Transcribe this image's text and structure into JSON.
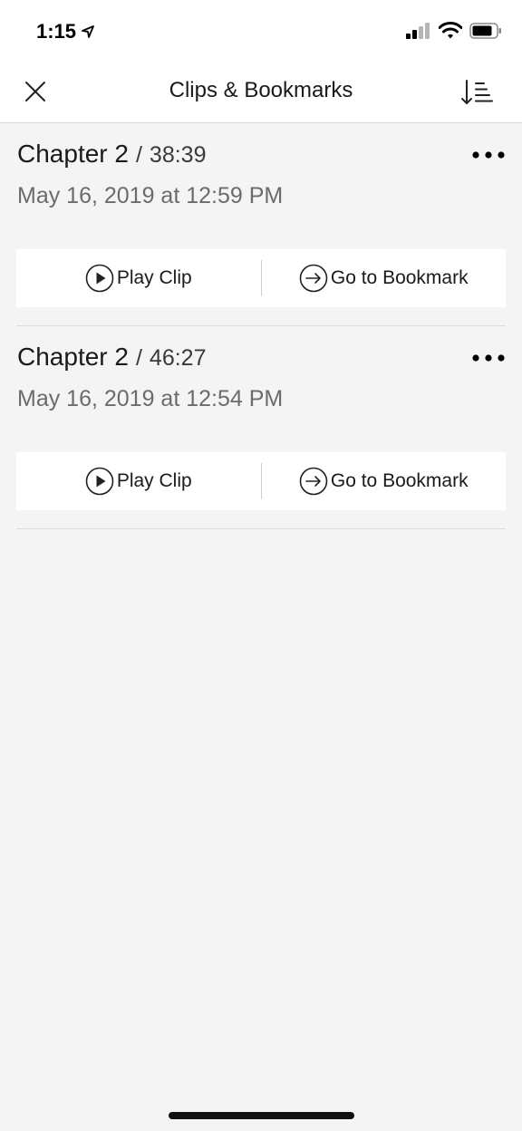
{
  "status_bar": {
    "time": "1:15"
  },
  "nav": {
    "title": "Clips & Bookmarks",
    "close_icon": "close-icon",
    "sort_icon": "sort-icon"
  },
  "items": [
    {
      "chapter": "Chapter 2",
      "separator": "/",
      "time": "38:39",
      "date": "May 16, 2019 at 12:59 PM",
      "play_label": "Play Clip",
      "bookmark_label": "Go to Bookmark"
    },
    {
      "chapter": "Chapter 2",
      "separator": "/",
      "time": "46:27",
      "date": "May 16, 2019 at 12:54 PM",
      "play_label": "Play Clip",
      "bookmark_label": "Go to Bookmark"
    }
  ]
}
